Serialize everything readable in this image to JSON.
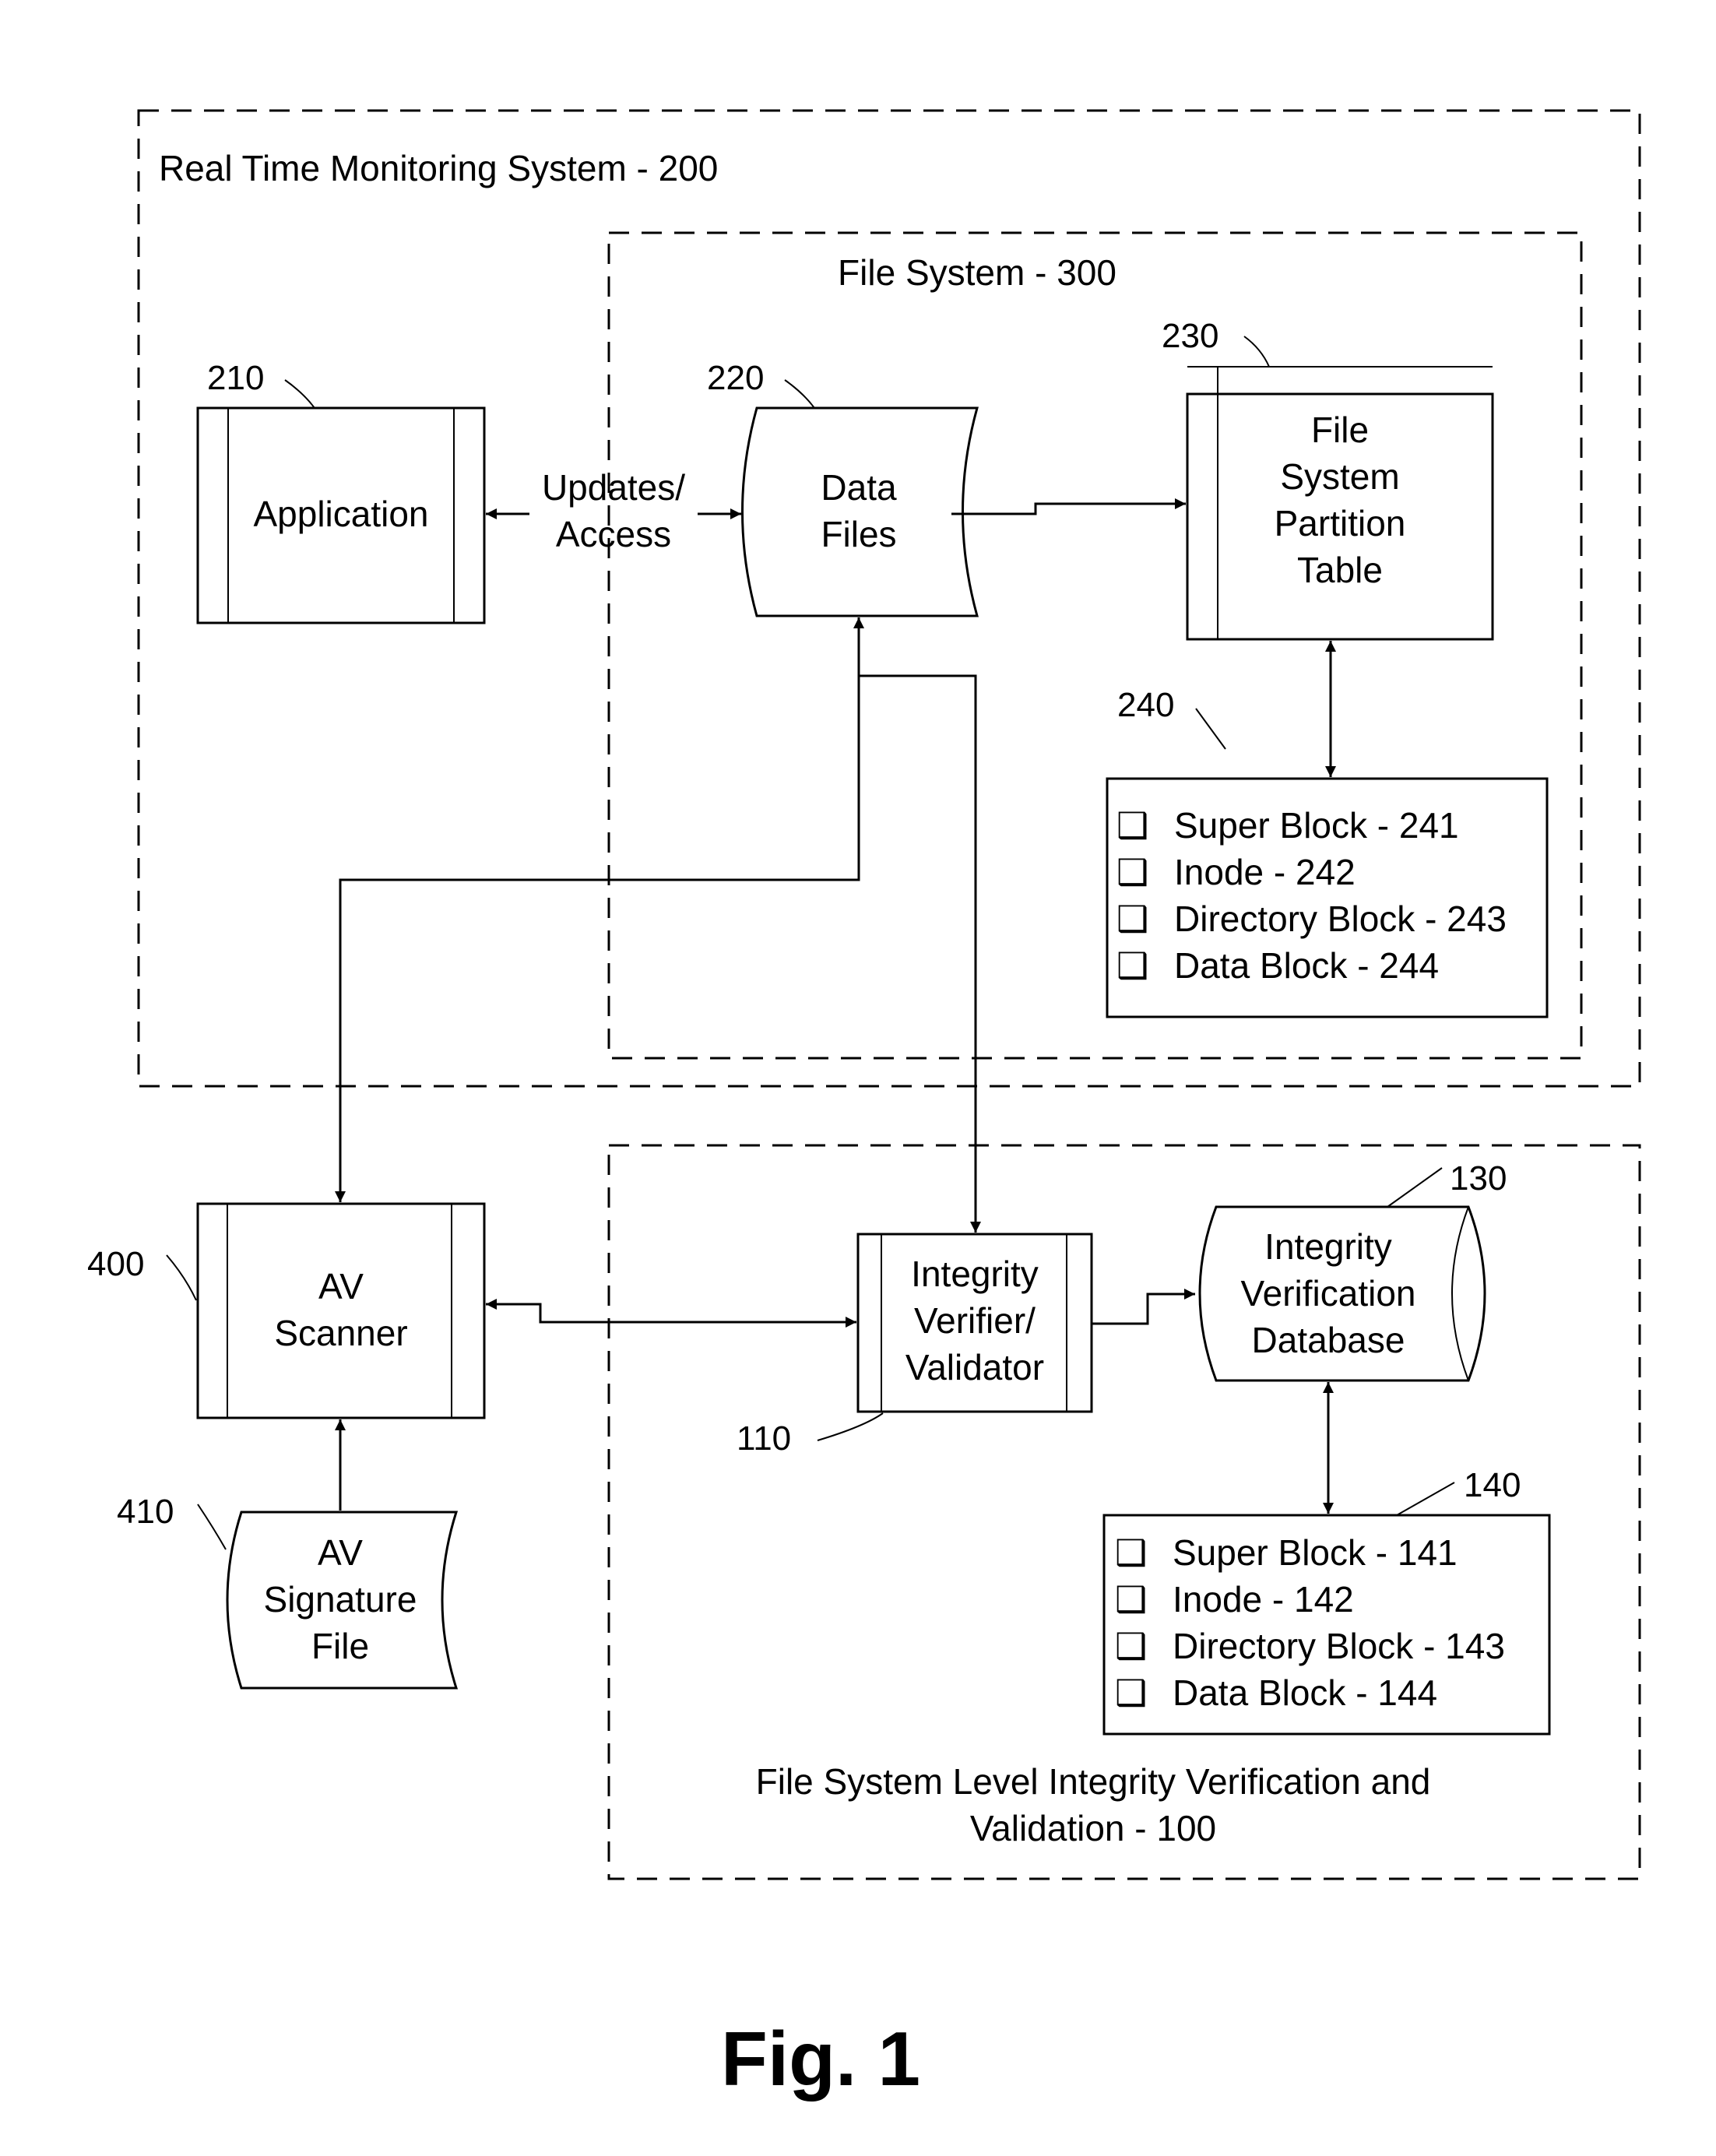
{
  "figure_label": "Fig. 1",
  "containers": {
    "real_time_monitoring": "Real Time Monitoring System - 200",
    "file_system": "File System - 300",
    "integrity_verification": [
      "File System Level Integrity Verification and",
      "Validation - 100"
    ]
  },
  "nodes": {
    "application": {
      "ref": "210",
      "lines": [
        "Application"
      ]
    },
    "data_files": {
      "ref": "220",
      "lines": [
        "Data",
        "Files"
      ]
    },
    "partition_table": {
      "ref": "230",
      "lines": [
        "File",
        "System",
        "Partition",
        "Table"
      ]
    },
    "av_scanner": {
      "ref": "400",
      "lines": [
        "AV",
        "Scanner"
      ]
    },
    "av_signature": {
      "ref": "410",
      "lines": [
        "AV",
        "Signature",
        "File"
      ]
    },
    "integrity_verifier": {
      "ref": "110",
      "lines": [
        "Integrity",
        "Verifier/",
        "Validator"
      ]
    },
    "integrity_db": {
      "ref": "130",
      "lines": [
        "Integrity",
        "Verification",
        "Database"
      ]
    }
  },
  "edge_labels": {
    "updates_access": [
      "Updates/",
      "Access"
    ]
  },
  "lists": {
    "fs_metadata": {
      "ref": "240",
      "bullet": "❑",
      "items": [
        "Super Block - 241",
        "Inode - 242",
        "Directory Block - 243",
        "Data Block - 244"
      ]
    },
    "verification_metadata": {
      "ref": "140",
      "bullet": "❑",
      "items": [
        "Super Block - 141",
        "Inode - 142",
        "Directory Block - 143",
        "Data Block - 144"
      ]
    }
  }
}
